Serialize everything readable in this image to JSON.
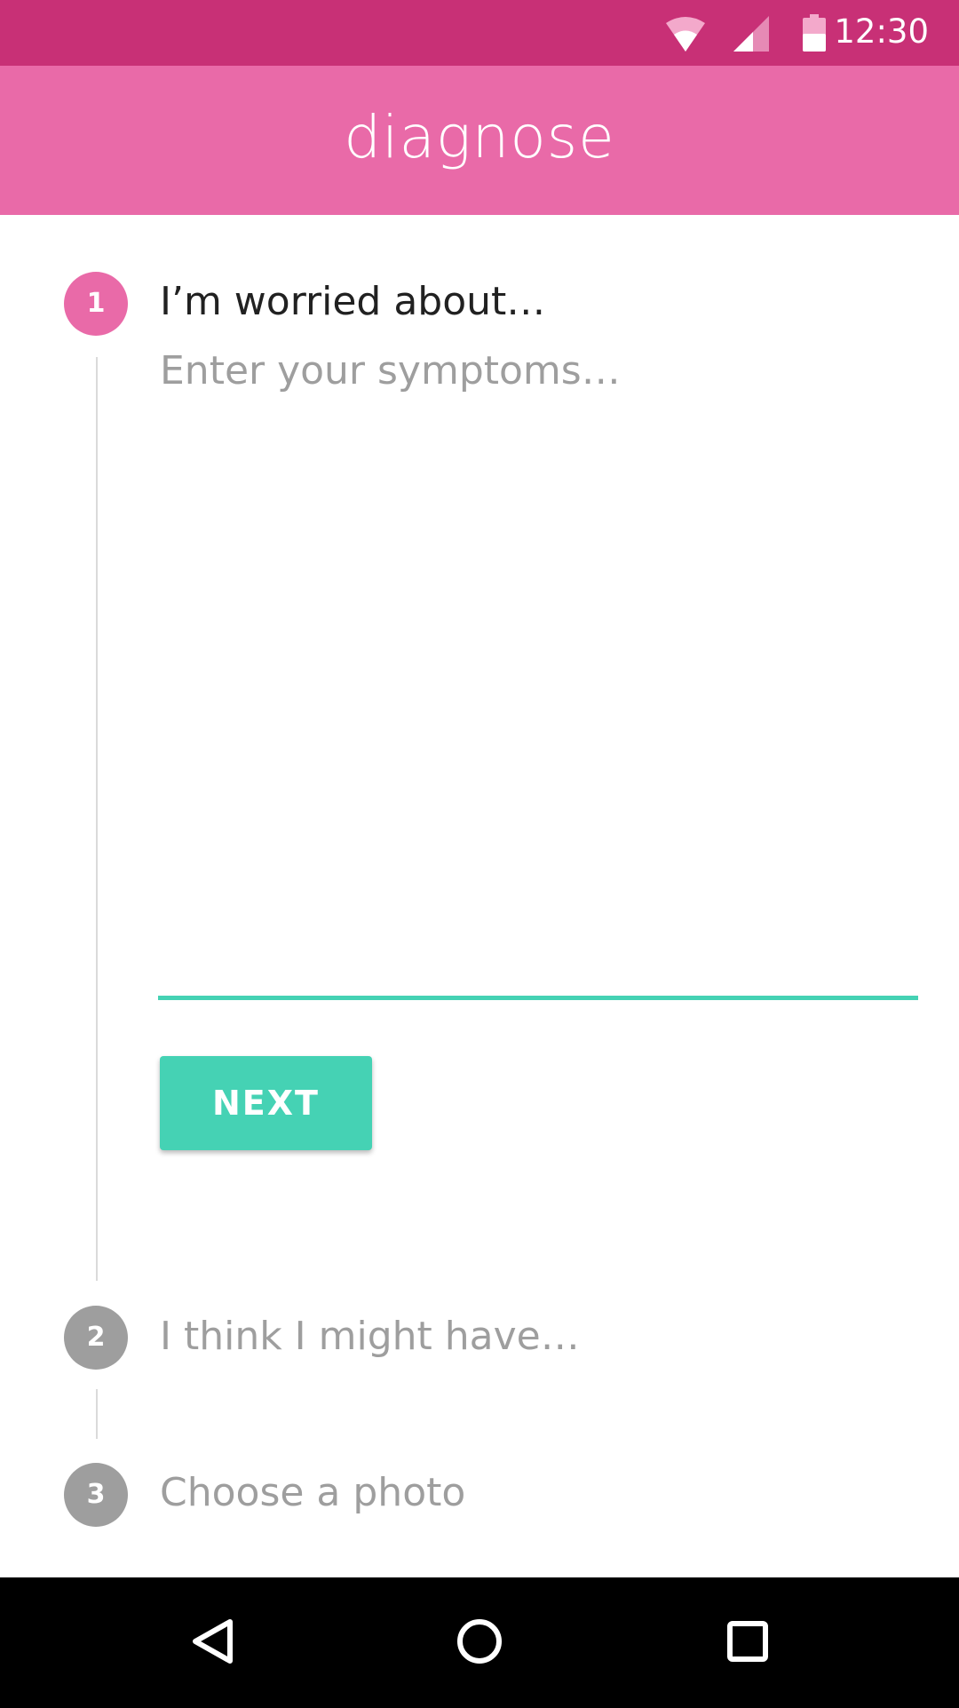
{
  "status_bar": {
    "time": "12:30",
    "background": "#C83076",
    "icons": [
      "wifi-icon",
      "signal-icon",
      "battery-icon"
    ]
  },
  "app_bar": {
    "title": "diagnose",
    "background": "#E96AA8"
  },
  "stepper": {
    "accent": "#E96AA8",
    "inactive_color": "#9E9E9E",
    "steps": [
      {
        "number": "1",
        "title": "I’m worried about…",
        "state": "active"
      },
      {
        "number": "2",
        "title": "I think I might have…",
        "state": "inactive"
      },
      {
        "number": "3",
        "title": "Choose a photo",
        "state": "inactive"
      }
    ]
  },
  "symptoms": {
    "value": "",
    "placeholder": "Enter your symptoms…",
    "underline_color": "#45D2B4"
  },
  "next_button": {
    "label": "NEXT",
    "background": "#45D2B4"
  },
  "nav_bar": {
    "icons": [
      "back-icon",
      "home-icon",
      "recents-icon"
    ]
  }
}
